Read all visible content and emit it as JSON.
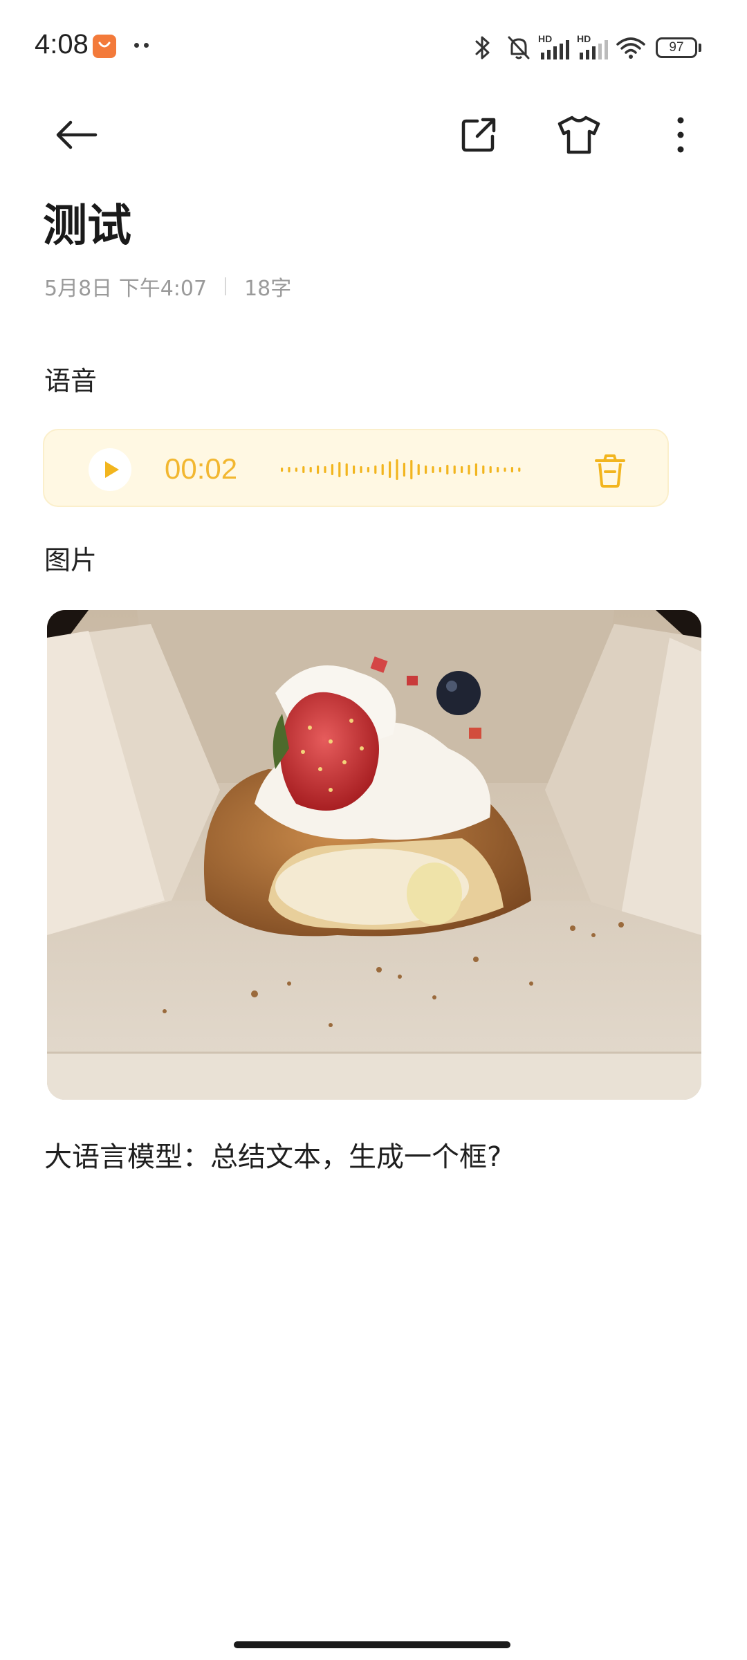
{
  "status_bar": {
    "time": "4:08",
    "battery": "97",
    "hd_label": "HD",
    "icons": [
      "app-notification-icon",
      "more-dots-icon",
      "bluetooth-icon",
      "silent-bell-icon",
      "cell-signal-icon",
      "cell-signal-icon",
      "wifi-icon",
      "battery-icon"
    ]
  },
  "toolbar": {
    "icons": [
      "back-arrow-icon",
      "share-external-icon",
      "theme-shirt-icon",
      "more-vertical-icon"
    ]
  },
  "note": {
    "title": "测试",
    "date": "5月8日 下午4:07",
    "char_count": "18字"
  },
  "sections": {
    "voice_label": "语音",
    "image_label": "图片"
  },
  "voice": {
    "duration": "00:02",
    "accent_color": "#f2b51e",
    "background_color": "#fff8e3"
  },
  "image": {
    "subject": "strawberry cream croissant in paper box"
  },
  "body_text": "大语言模型：总结文本，生成一个框?"
}
